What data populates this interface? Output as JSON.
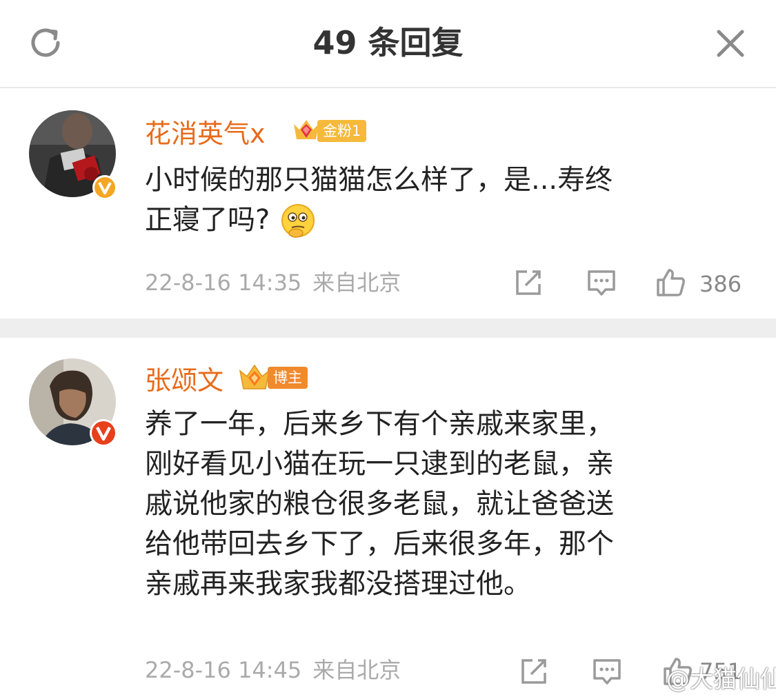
{
  "header": {
    "title": "49 条回复",
    "refresh_icon": "refresh-icon",
    "close_icon": "close-icon"
  },
  "comments": [
    {
      "username": "花消英气x",
      "badge": "金粉1",
      "badge_icon": "crown-diamond-icon",
      "verified_icon": "verified-v-icon",
      "verified_color": "#f5a623",
      "content_lines": [
        "小时候的那只猫猫怎么样了，是...寿终",
        "正寝了吗?"
      ],
      "emoji": "thinking-emoji-icon",
      "timestamp": "22-8-16 14:35",
      "location": "来自北京",
      "likes": "386"
    },
    {
      "username": "张颂文",
      "badge": "博主",
      "badge_icon": "crown-diamond-icon",
      "verified_icon": "verified-v-icon",
      "verified_color": "#e8401c",
      "content_lines": [
        "养了一年，后来乡下有个亲戚来家里，",
        "刚好看见小猫在玩一只逮到的老鼠，亲",
        "戚说他家的粮仓很多老鼠，就让爸爸送",
        "给他带回去乡下了，后来很多年，那个",
        "亲戚再来我家我都没搭理过他。"
      ],
      "timestamp": "22-8-16 14:45",
      "location": "来自北京",
      "likes": "751"
    }
  ],
  "watermark": "@大猫仙仙",
  "colors": {
    "username": "#e86b1a",
    "meta": "#aaaaaa",
    "divider": "#eeeeee",
    "gold_badge": "#f5b93c",
    "orange_badge": "#f08a2c"
  }
}
